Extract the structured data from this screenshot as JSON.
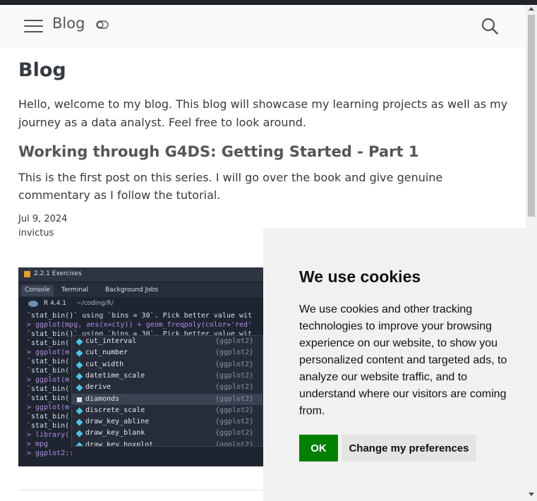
{
  "navbar": {
    "brand": "Blog",
    "menu_icon": "hamburger-menu-icon",
    "toggle_icon": "color-mode-toggle-icon",
    "search_icon": "search-icon"
  },
  "page": {
    "title": "Blog",
    "intro": "Hello, welcome to my blog. This blog will showcase my learning projects as well as my journey as a data analyst. Feel free to look around."
  },
  "post": {
    "title": "Working through G4DS: Getting Started - Part 1",
    "description": "This is the first post on this series. I will go over the book and give genuine commentary as I follow the tutorial.",
    "date": "Jul 9, 2024",
    "author": "invictus",
    "thumbnail": {
      "window_title": "2.2.1 Exercises",
      "tabs": [
        "Console",
        "Terminal",
        "Background Jobs"
      ],
      "r_version": "R 4.4.1",
      "path": "~/coding/R/",
      "console_lines": [
        {
          "kind": "out",
          "text": "`stat_bin()` using `bins = 30`. Pick better value wit"
        },
        {
          "kind": "prompt",
          "text": "> ggplot(mpg, aes(x=cty)) + geom_freqpoly(color='red'"
        },
        {
          "kind": "out",
          "text": "`stat_bin()` using `bins = 30`. Pick better value wit"
        },
        {
          "kind": "out",
          "text": "`stat_bin("
        },
        {
          "kind": "prompt",
          "text": "> ggplot(m"
        },
        {
          "kind": "out",
          "text": "`stat_bin("
        },
        {
          "kind": "out",
          "text": "`stat_bin("
        },
        {
          "kind": "prompt",
          "text": "> ggplot(m"
        },
        {
          "kind": "out",
          "text": "`stat_bin("
        },
        {
          "kind": "out",
          "text": "`stat_bin("
        },
        {
          "kind": "prompt",
          "text": "> ggplot(m"
        },
        {
          "kind": "out",
          "text": "`stat_bin("
        },
        {
          "kind": "out",
          "text": "`stat_bin("
        },
        {
          "kind": "prompt",
          "text": "> library("
        },
        {
          "kind": "prompt",
          "text": "> mpg"
        },
        {
          "kind": "prompt",
          "text": "> ggplot2::"
        }
      ],
      "completions": [
        {
          "name": "cut_interval",
          "pkg": "{ggplot2}",
          "selected": false,
          "icon": "function"
        },
        {
          "name": "cut_number",
          "pkg": "{ggplot2}",
          "selected": false,
          "icon": "function"
        },
        {
          "name": "cut_width",
          "pkg": "{ggplot2}",
          "selected": false,
          "icon": "function"
        },
        {
          "name": "datetime_scale",
          "pkg": "{ggplot2}",
          "selected": false,
          "icon": "function"
        },
        {
          "name": "derive",
          "pkg": "{ggplot2}",
          "selected": false,
          "icon": "function"
        },
        {
          "name": "diamonds",
          "pkg": "{ggplot2}",
          "selected": true,
          "icon": "dataset"
        },
        {
          "name": "discrete_scale",
          "pkg": "{ggplot2}",
          "selected": false,
          "icon": "function"
        },
        {
          "name": "draw_key_abline",
          "pkg": "{ggplot2}",
          "selected": false,
          "icon": "function"
        },
        {
          "name": "draw_key_blank",
          "pkg": "{ggplot2}",
          "selected": false,
          "icon": "function"
        },
        {
          "name": "draw_key_boxplot",
          "pkg": "{ggplot2}",
          "selected": false,
          "icon": "function"
        }
      ]
    }
  },
  "cookie": {
    "title": "We use cookies",
    "text": "We use cookies and other tracking technologies to improve your browsing experience on our website, to show you personalized content and targeted ads, to analyze our website traffic, and to understand where our visitors are coming from.",
    "ok_label": "OK",
    "preferences_label": "Change my preferences",
    "ok_color": "#008000"
  }
}
